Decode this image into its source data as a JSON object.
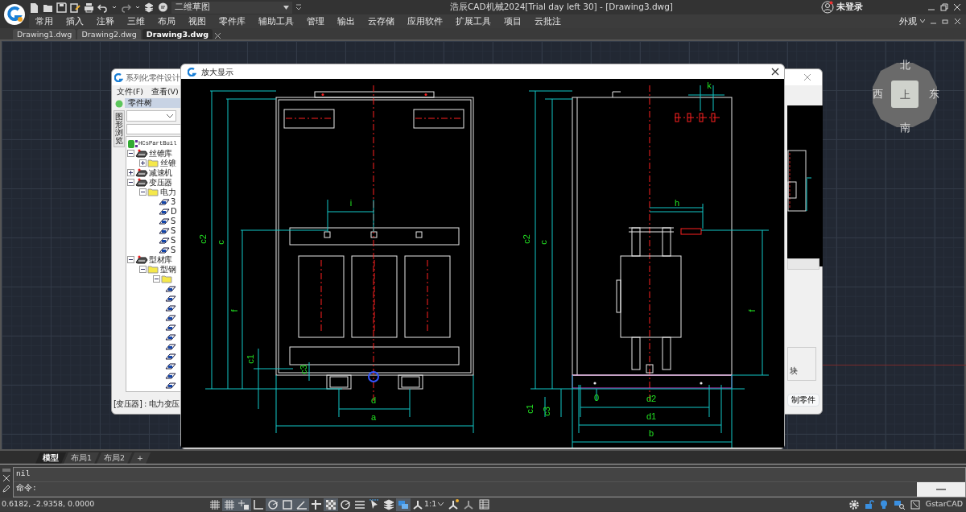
{
  "window": {
    "title": "浩辰CAD机械2024[Trial day left 30] - [Drawing3.dwg]",
    "user": "未登录"
  },
  "workspace_dropdown": {
    "value": "二维草图"
  },
  "menu": [
    "常用",
    "插入",
    "注释",
    "三维",
    "布局",
    "视图",
    "零件库",
    "辅助工具",
    "管理",
    "输出",
    "云存储",
    "应用软件",
    "扩展工具",
    "项目",
    "云批注"
  ],
  "appearance_menu": "外观",
  "doc_tabs": [
    {
      "label": "Drawing1.dwg",
      "selected": false
    },
    {
      "label": "Drawing2.dwg",
      "selected": false
    },
    {
      "label": "Drawing3.dwg",
      "selected": true
    }
  ],
  "part_dialog": {
    "title": "系列化零件设计",
    "menu": [
      "文件(F)",
      "查看(V)"
    ],
    "side_tab": "图形浏览",
    "tree_title": "零件树",
    "tree": [
      {
        "label": "HCsPartBuil",
        "kind": "root",
        "children": [
          {
            "label": "丝锥库",
            "kind": "library",
            "expanded": true,
            "children": [
              {
                "label": "丝锥",
                "kind": "folder",
                "expanded": false
              }
            ]
          },
          {
            "label": "减速机",
            "kind": "library",
            "expanded": false
          },
          {
            "label": "变压器",
            "kind": "library",
            "expanded": true,
            "children": [
              {
                "label": "电力",
                "kind": "folder",
                "expanded": true,
                "children": [
                  {
                    "label": "3",
                    "kind": "part"
                  },
                  {
                    "label": "D",
                    "kind": "part"
                  },
                  {
                    "label": "S",
                    "kind": "part"
                  },
                  {
                    "label": "S",
                    "kind": "part"
                  },
                  {
                    "label": "S",
                    "kind": "part"
                  },
                  {
                    "label": "S",
                    "kind": "part"
                  }
                ]
              }
            ]
          },
          {
            "label": "型材库",
            "kind": "library",
            "expanded": true,
            "children": [
              {
                "label": "型钢",
                "kind": "folder",
                "expanded": true,
                "children": [
                  {
                    "kind": "folder",
                    "expanded": true,
                    "children": [
                      {
                        "kind": "part"
                      },
                      {
                        "kind": "part"
                      },
                      {
                        "kind": "part"
                      },
                      {
                        "kind": "part"
                      },
                      {
                        "kind": "part"
                      },
                      {
                        "kind": "part"
                      },
                      {
                        "kind": "part"
                      },
                      {
                        "kind": "part"
                      },
                      {
                        "kind": "part"
                      },
                      {
                        "kind": "part"
                      },
                      {
                        "kind": "part"
                      }
                    ]
                  }
                ]
              }
            ]
          }
        ]
      }
    ],
    "status": "[变压器] : 电力变压",
    "right_label": "块",
    "right_button": "制零件"
  },
  "zoom_dialog": {
    "title": "放大显示",
    "labels": [
      "c2",
      "c",
      "f",
      "c1",
      "c3",
      "i",
      "d",
      "a",
      "k",
      "c2",
      "c",
      "h",
      "f",
      "c1",
      "c3",
      "0",
      "d2",
      "d1",
      "b"
    ]
  },
  "view_cube": {
    "north": "北",
    "west": "西",
    "top": "上",
    "east": "东",
    "south": "南"
  },
  "layout_tabs": [
    {
      "label": "模型",
      "selected": true
    },
    {
      "label": "布局1",
      "selected": false
    },
    {
      "label": "布局2",
      "selected": false
    },
    {
      "label": "+",
      "selected": false
    }
  ],
  "command": {
    "history": "nil",
    "prompt": "命令:"
  },
  "status_bar": {
    "coordinates": "0.6182, -2.9358, 0.0000",
    "toggles": [
      {
        "kind": "grid",
        "on": false
      },
      {
        "kind": "grid",
        "on": true
      },
      {
        "kind": "snap",
        "on": true
      },
      {
        "kind": "ortho",
        "on": false
      },
      {
        "kind": "polar",
        "on": true
      },
      {
        "kind": "osnap",
        "on": true
      },
      {
        "kind": "angle",
        "on": true
      },
      {
        "kind": "track",
        "on": false
      },
      {
        "kind": "checker",
        "on": true
      },
      {
        "kind": "polar",
        "on": false
      },
      {
        "kind": "lines",
        "on": false
      },
      {
        "kind": "cursor",
        "on": false
      },
      {
        "kind": "layers",
        "on": false
      },
      {
        "kind": "select",
        "on": true
      }
    ],
    "scale": "1:1",
    "app": "GstarCAD"
  }
}
